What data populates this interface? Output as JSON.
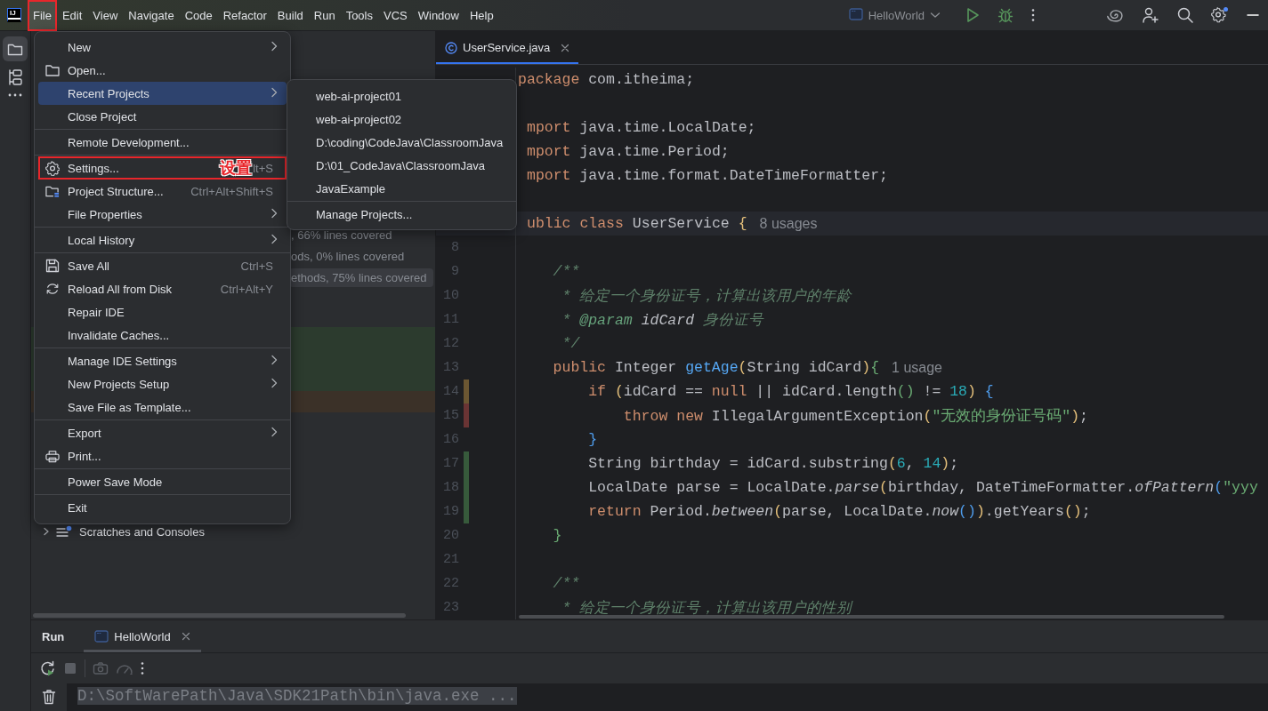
{
  "window": {
    "logo": "IJ",
    "menubar": [
      {
        "label": "File",
        "selected": true,
        "annotated": true
      },
      {
        "label": "Edit",
        "selected": false,
        "annotated": false
      },
      {
        "label": "View",
        "selected": false,
        "annotated": false
      },
      {
        "label": "Navigate",
        "selected": false,
        "annotated": false
      },
      {
        "label": "Code",
        "selected": false,
        "annotated": false
      },
      {
        "label": "Refactor",
        "selected": false,
        "annotated": false
      },
      {
        "label": "Build",
        "selected": false,
        "annotated": false
      },
      {
        "label": "Run",
        "selected": false,
        "annotated": false
      },
      {
        "label": "Tools",
        "selected": false,
        "annotated": false
      },
      {
        "label": "VCS",
        "selected": false,
        "annotated": false
      },
      {
        "label": "Window",
        "selected": false,
        "annotated": false
      },
      {
        "label": "Help",
        "selected": false,
        "annotated": false
      }
    ],
    "run_config": {
      "label": "HelloWorld"
    }
  },
  "file_menu": {
    "items": [
      {
        "kind": "item",
        "label": "New",
        "submenu": true,
        "selected": false
      },
      {
        "kind": "item",
        "label": "Open...",
        "selected": false
      },
      {
        "kind": "item",
        "label": "Recent Projects",
        "submenu": true,
        "selected": true
      },
      {
        "kind": "item",
        "label": "Close Project",
        "selected": false
      },
      {
        "kind": "separator"
      },
      {
        "kind": "item",
        "label": "Remote Development...",
        "selected": false
      },
      {
        "kind": "separator"
      },
      {
        "kind": "item",
        "label": "Settings...",
        "shortcut": "lt+S",
        "selected": false,
        "annotated": true,
        "callout": "设置"
      },
      {
        "kind": "item",
        "label": "Project Structure...",
        "shortcut": "Ctrl+Alt+Shift+S",
        "selected": false
      },
      {
        "kind": "item",
        "label": "File Properties",
        "submenu": true,
        "selected": false
      },
      {
        "kind": "separator"
      },
      {
        "kind": "item",
        "label": "Local History",
        "submenu": true,
        "selected": false
      },
      {
        "kind": "separator"
      },
      {
        "kind": "item",
        "label": "Save All",
        "shortcut": "Ctrl+S",
        "selected": false
      },
      {
        "kind": "item",
        "label": "Reload All from Disk",
        "shortcut": "Ctrl+Alt+Y",
        "selected": false
      },
      {
        "kind": "item",
        "label": "Repair IDE",
        "selected": false
      },
      {
        "kind": "item",
        "label": "Invalidate Caches...",
        "selected": false
      },
      {
        "kind": "separator"
      },
      {
        "kind": "item",
        "label": "Manage IDE Settings",
        "submenu": true,
        "selected": false
      },
      {
        "kind": "item",
        "label": "New Projects Setup",
        "submenu": true,
        "selected": false
      },
      {
        "kind": "item",
        "label": "Save File as Template...",
        "selected": false
      },
      {
        "kind": "separator"
      },
      {
        "kind": "item",
        "label": "Export",
        "submenu": true,
        "selected": false
      },
      {
        "kind": "item",
        "label": "Print...",
        "selected": false
      },
      {
        "kind": "separator"
      },
      {
        "kind": "item",
        "label": "Power Save Mode",
        "selected": false
      },
      {
        "kind": "separator"
      },
      {
        "kind": "item",
        "label": "Exit",
        "selected": false
      }
    ]
  },
  "recent_projects_menu": {
    "items": [
      {
        "kind": "item",
        "label": "web-ai-project01",
        "selected": false
      },
      {
        "kind": "item",
        "label": "web-ai-project02",
        "selected": false
      },
      {
        "kind": "item",
        "label": "D:\\coding\\CodeJava\\ClassroomJava",
        "selected": false
      },
      {
        "kind": "item",
        "label": "D:\\01_CodeJava\\ClassroomJava",
        "selected": false
      },
      {
        "kind": "item",
        "label": "JavaExample",
        "selected": false
      },
      {
        "kind": "separator"
      },
      {
        "kind": "item",
        "label": "Manage Projects...",
        "selected": false
      }
    ]
  },
  "project_panel": {
    "rows": [
      {
        "text": ", 66% lines covered",
        "selected": false
      },
      {
        "text": "ods, 0% lines covered",
        "selected": false
      },
      {
        "text": "ethods, 75% lines covered",
        "selected": true
      }
    ],
    "coverage_rows": [
      {
        "color": "#2c3b2e"
      },
      {
        "color": "#2c3b2e"
      },
      {
        "color": "#2c3b2e"
      },
      {
        "color": "#3b3128"
      }
    ],
    "tree": [
      {
        "label": "Scratches and Consoles",
        "expanded": false
      }
    ]
  },
  "editor": {
    "tabs": [
      {
        "label": "UserService.java",
        "selected": true
      }
    ],
    "lines": [
      {
        "kind": "code",
        "tokens": [
          {
            "kind": "kw",
            "text": "package"
          },
          {
            "kind": "tx",
            "text": " com.itheima;"
          }
        ]
      },
      {
        "kind": "blank"
      },
      {
        "kind": "code",
        "cut_left": true,
        "tokens": [
          {
            "kind": "kw",
            "text": "mport"
          },
          {
            "kind": "tx",
            "text": " java.time.LocalDate;"
          }
        ]
      },
      {
        "kind": "code",
        "cut_left": true,
        "tokens": [
          {
            "kind": "kw",
            "text": "mport"
          },
          {
            "kind": "tx",
            "text": " java.time.Period;"
          }
        ]
      },
      {
        "kind": "code",
        "cut_left": true,
        "tokens": [
          {
            "kind": "kw",
            "text": "mport"
          },
          {
            "kind": "tx",
            "text": " java.time.format.DateTimeFormatter;"
          }
        ]
      },
      {
        "kind": "blank"
      },
      {
        "kind": "code",
        "cut_left": true,
        "current": true,
        "tokens": [
          {
            "kind": "kw",
            "text": "ublic class"
          },
          {
            "kind": "tx",
            "text": " UserService "
          },
          {
            "kind": "p1",
            "text": "{"
          },
          {
            "kind": "hint",
            "text": "8 usages"
          }
        ]
      },
      {
        "kind": "blank",
        "number": "8"
      },
      {
        "kind": "code",
        "number": "9",
        "tokens": [
          {
            "kind": "cm",
            "text": "    /**"
          }
        ]
      },
      {
        "kind": "code",
        "number": "10",
        "tokens": [
          {
            "kind": "cm",
            "text": "     * 给定一个身份证号，计算出该用户的年龄"
          }
        ]
      },
      {
        "kind": "code",
        "number": "11",
        "tokens": [
          {
            "kind": "cm",
            "text": "     * "
          },
          {
            "kind": "tag",
            "text": "@param"
          },
          {
            "kind": "pi",
            "text": " idCard "
          },
          {
            "kind": "cm",
            "text": "身份证号"
          }
        ]
      },
      {
        "kind": "code",
        "number": "12",
        "tokens": [
          {
            "kind": "cm",
            "text": "     */"
          }
        ]
      },
      {
        "kind": "code",
        "number": "13",
        "tokens": [
          {
            "kind": "kw",
            "text": "    public"
          },
          {
            "kind": "tx",
            "text": " Integer "
          },
          {
            "kind": "fn",
            "text": "getAge"
          },
          {
            "kind": "p1",
            "text": "("
          },
          {
            "kind": "tx",
            "text": "String idCard"
          },
          {
            "kind": "p1",
            "text": ")"
          },
          {
            "kind": "p3",
            "text": "{"
          },
          {
            "kind": "hint",
            "text": "1 usage"
          }
        ]
      },
      {
        "kind": "code",
        "number": "14",
        "color": "#6b5632",
        "tokens": [
          {
            "kind": "kw",
            "text": "        if "
          },
          {
            "kind": "p1",
            "text": "("
          },
          {
            "kind": "tx",
            "text": "idCard == "
          },
          {
            "kind": "kw",
            "text": "null"
          },
          {
            "kind": "tx",
            "text": " || idCard.length"
          },
          {
            "kind": "p3",
            "text": "()"
          },
          {
            "kind": "tx",
            "text": " != "
          },
          {
            "kind": "num",
            "text": "18"
          },
          {
            "kind": "p1",
            "text": ")"
          },
          {
            "kind": "p2",
            "text": " {"
          }
        ]
      },
      {
        "kind": "code",
        "number": "15",
        "color": "#6a3434",
        "tokens": [
          {
            "kind": "kw",
            "text": "            throw new"
          },
          {
            "kind": "tx",
            "text": " IllegalArgumentException"
          },
          {
            "kind": "p1",
            "text": "("
          },
          {
            "kind": "str",
            "text": "\"无效的身份证号码\""
          },
          {
            "kind": "p1",
            "text": ")"
          },
          {
            "kind": "tx",
            "text": ";"
          }
        ]
      },
      {
        "kind": "code",
        "number": "16",
        "tokens": [
          {
            "kind": "p2",
            "text": "        }"
          }
        ]
      },
      {
        "kind": "code",
        "number": "17",
        "color": "#375a3b",
        "tokens": [
          {
            "kind": "tx",
            "text": "        String birthday = idCard.substring"
          },
          {
            "kind": "p1",
            "text": "("
          },
          {
            "kind": "num",
            "text": "6"
          },
          {
            "kind": "tx",
            "text": ", "
          },
          {
            "kind": "num",
            "text": "14"
          },
          {
            "kind": "p1",
            "text": ")"
          },
          {
            "kind": "tx",
            "text": ";"
          }
        ]
      },
      {
        "kind": "code",
        "number": "18",
        "color": "#375a3b",
        "tokens": [
          {
            "kind": "tx",
            "text": "        LocalDate parse = LocalDate."
          },
          {
            "kind": "it",
            "text": "parse"
          },
          {
            "kind": "p1",
            "text": "("
          },
          {
            "kind": "tx",
            "text": "birthday, DateTimeFormatter."
          },
          {
            "kind": "it",
            "text": "ofPattern"
          },
          {
            "kind": "p2",
            "text": "("
          },
          {
            "kind": "str",
            "text": "\"yyy"
          }
        ]
      },
      {
        "kind": "code",
        "number": "19",
        "color": "#375a3b",
        "tokens": [
          {
            "kind": "kw",
            "text": "        return"
          },
          {
            "kind": "tx",
            "text": " Period."
          },
          {
            "kind": "it",
            "text": "between"
          },
          {
            "kind": "p1",
            "text": "("
          },
          {
            "kind": "tx",
            "text": "parse, LocalDate."
          },
          {
            "kind": "it",
            "text": "now"
          },
          {
            "kind": "p2",
            "text": "()"
          },
          {
            "kind": "p1",
            "text": ")"
          },
          {
            "kind": "tx",
            "text": ".getYears"
          },
          {
            "kind": "p1",
            "text": "()"
          },
          {
            "kind": "tx",
            "text": ";"
          }
        ]
      },
      {
        "kind": "code",
        "number": "20",
        "tokens": [
          {
            "kind": "p3",
            "text": "    }"
          }
        ]
      },
      {
        "kind": "blank",
        "number": "21"
      },
      {
        "kind": "code",
        "number": "22",
        "tokens": [
          {
            "kind": "cm",
            "text": "    /**"
          }
        ]
      },
      {
        "kind": "code",
        "number": "23",
        "tokens": [
          {
            "kind": "cm",
            "text": "     * 给定一个身份证号，计算出该用户的性别"
          }
        ]
      }
    ]
  },
  "run_panel": {
    "title": "Run",
    "tabs": [
      {
        "label": "HelloWorld",
        "selected": true
      }
    ],
    "console": [
      {
        "text": "D:\\SoftWarePath\\Java\\SDK21Path\\bin\\java.exe ...",
        "selected": true
      }
    ]
  }
}
